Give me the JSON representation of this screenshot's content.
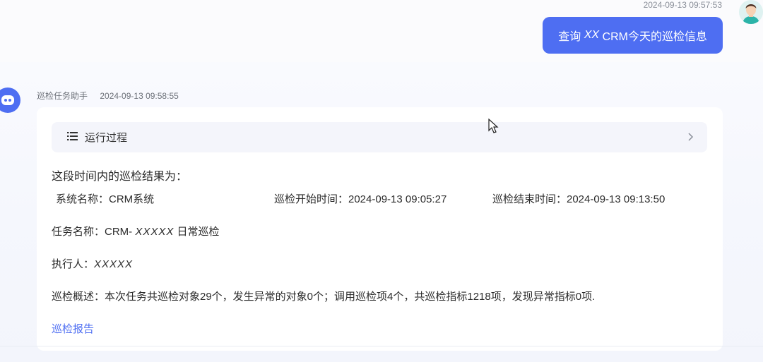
{
  "user_message": {
    "timestamp": "2024-09-13 09:57:53",
    "text_prefix": "查询",
    "text_em": "XX",
    "text_suffix": "CRM今天的巡检信息"
  },
  "bot_message": {
    "sender": "巡检任务助手",
    "timestamp": "2024-09-13 09:58:55",
    "process_label": "运行过程",
    "heading": "这段时间内的巡检结果为：",
    "system_name": "系统名称：CRM系统",
    "start_time": "巡检开始时间：2024-09-13 09:05:27",
    "end_time": "巡检结束时间：2024-09-13 09:13:50",
    "task_label": "任务名称：CRM-",
    "task_em": "XXXXX",
    "task_suffix": "日常巡检",
    "executor_label": "执行人：",
    "executor_em": "XXXXX",
    "summary": "巡检概述：本次任务共巡检对象29个，发生异常的对象0个；调用巡检项4个，共巡检指标1218项，发现异常指标0项.",
    "report_link": "巡检报告"
  },
  "colors": {
    "accent": "#4e6ef2",
    "card_bg": "#ffffff",
    "process_bg": "#f4f5fb"
  },
  "icons": [
    "user-avatar-icon",
    "robot-icon",
    "list-icon",
    "chevron-right-icon",
    "mouse-cursor-icon"
  ]
}
